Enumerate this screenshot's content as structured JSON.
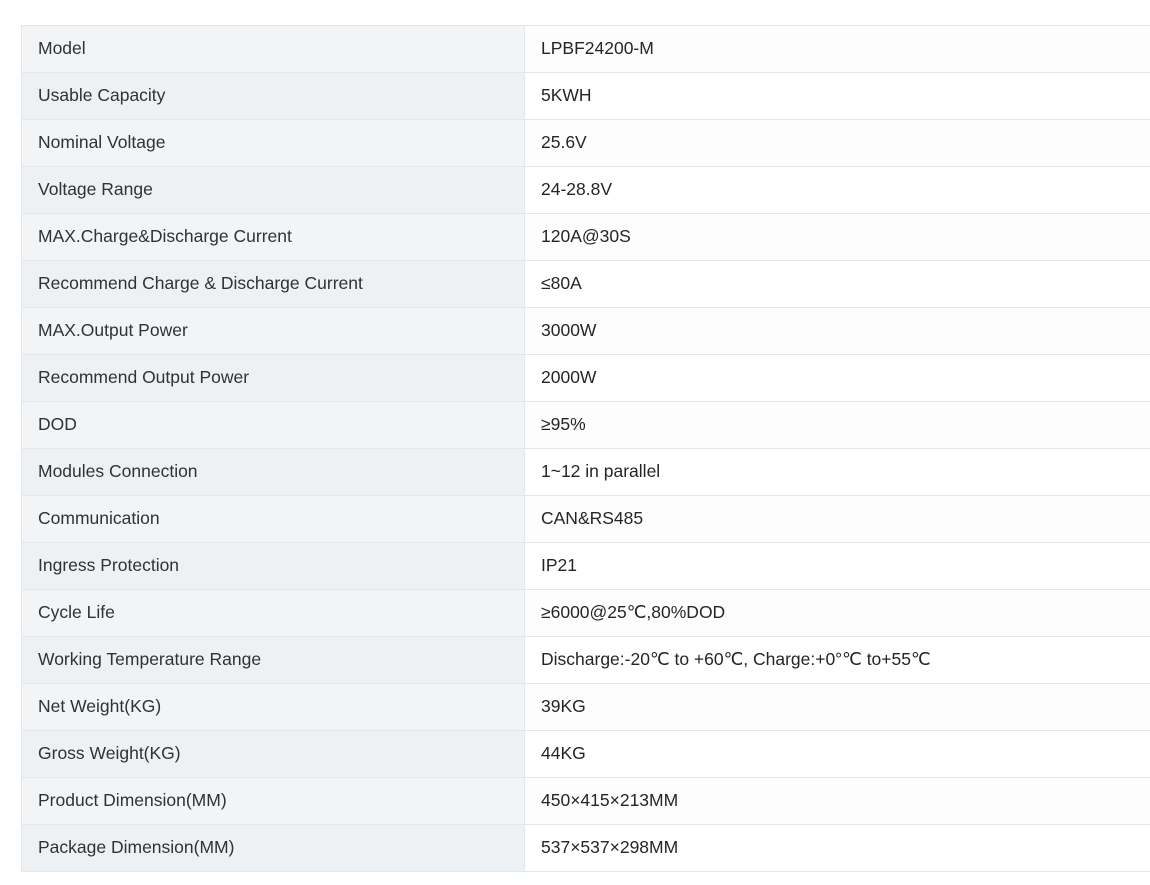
{
  "document": {
    "type": "product-specification-table",
    "colors": {
      "label_column_background": "#f2f4f6",
      "value_column_background": "#fdfdfd",
      "border": "#e3e6ea",
      "text": "#2b2f33",
      "page_background": "#ffffff"
    }
  },
  "spec_table": {
    "rows": [
      {
        "label": "Model",
        "value": "LPBF24200-M"
      },
      {
        "label": "Usable Capacity",
        "value": "5KWH"
      },
      {
        "label": "Nominal Voltage",
        "value": "25.6V"
      },
      {
        "label": "Voltage Range",
        "value": "24-28.8V"
      },
      {
        "label": "MAX.Charge&Discharge Current",
        "value": "120A@30S"
      },
      {
        "label": "Recommend Charge & Discharge Current",
        "value": "≤80A"
      },
      {
        "label": "MAX.Output Power",
        "value": "3000W"
      },
      {
        "label": "Recommend Output Power",
        "value": "2000W"
      },
      {
        "label": "DOD",
        "value": "≥95%"
      },
      {
        "label": "Modules Connection",
        "value": "1~12 in parallel"
      },
      {
        "label": "Communication",
        "value": "CAN&RS485"
      },
      {
        "label": "Ingress Protection",
        "value": "IP21"
      },
      {
        "label": "Cycle Life",
        "value": "≥6000@25℃,80%DOD"
      },
      {
        "label": "Working Temperature Range",
        "value": "Discharge:-20℃ to +60℃, Charge:+0°℃ to+55℃"
      },
      {
        "label": "Net Weight(KG)",
        "value": "39KG"
      },
      {
        "label": "Gross Weight(KG)",
        "value": "44KG"
      },
      {
        "label": "Product Dimension(MM)",
        "value": "450×415×213MM"
      },
      {
        "label": "Package Dimension(MM)",
        "value": "537×537×298MM"
      }
    ]
  }
}
